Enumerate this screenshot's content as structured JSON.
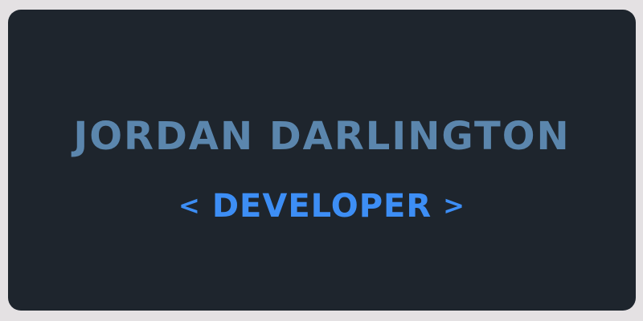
{
  "card": {
    "name": "JORDAN DARLINGTON",
    "role": {
      "open": "<",
      "title": "DEVELOPER",
      "close": ">"
    }
  },
  "colors": {
    "background": "#1e252d",
    "frame": "#e4e1e3",
    "name": "#5b86ad",
    "role": "#3d8ef5"
  }
}
